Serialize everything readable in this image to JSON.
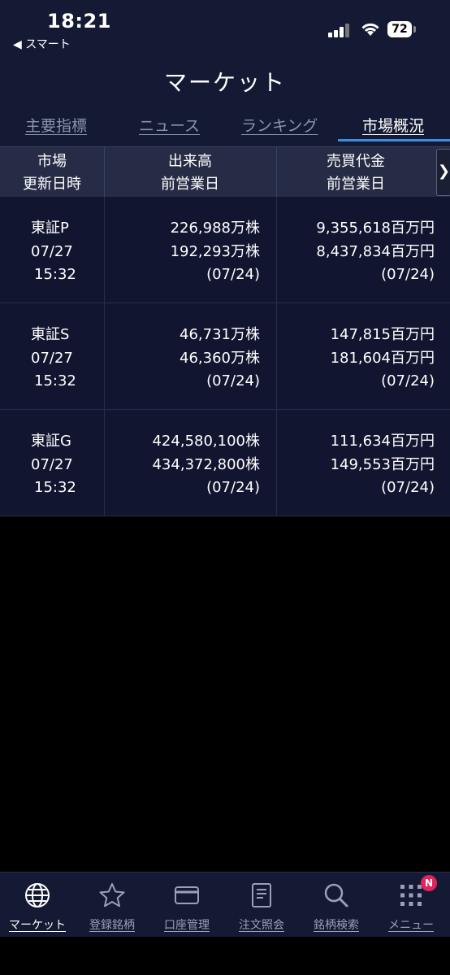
{
  "status_bar": {
    "time": "18:21",
    "back_app": "◀ スマート",
    "battery": "72"
  },
  "header": {
    "title": "マーケット"
  },
  "tabs": [
    {
      "label": "主要指標",
      "active": false
    },
    {
      "label": "ニュース",
      "active": false
    },
    {
      "label": "ランキング",
      "active": false
    },
    {
      "label": "市場概況",
      "active": true
    }
  ],
  "table": {
    "headers": [
      {
        "line1": "市場",
        "line2": "更新日時"
      },
      {
        "line1": "出来高",
        "line2": "前営業日"
      },
      {
        "line1": "売買代金",
        "line2": "前営業日"
      }
    ],
    "scroll_right": "❯",
    "rows": [
      {
        "market": "東証P",
        "date": "07/27",
        "time": "15:32",
        "volume": "226,988万株",
        "volume_prev": "192,293万株",
        "volume_prev_date": "(07/24)",
        "value": "9,355,618百万円",
        "value_prev": "8,437,834百万円",
        "value_prev_date": "(07/24)"
      },
      {
        "market": "東証S",
        "date": "07/27",
        "time": "15:32",
        "volume": "46,731万株",
        "volume_prev": "46,360万株",
        "volume_prev_date": "(07/24)",
        "value": "147,815百万円",
        "value_prev": "181,604百万円",
        "value_prev_date": "(07/24)"
      },
      {
        "market": "東証G",
        "date": "07/27",
        "time": "15:32",
        "volume": "424,580,100株",
        "volume_prev": "434,372,800株",
        "volume_prev_date": "(07/24)",
        "value": "111,634百万円",
        "value_prev": "149,553百万円",
        "value_prev_date": "(07/24)"
      }
    ]
  },
  "tab_bar": {
    "items": [
      {
        "label": "マーケット",
        "icon": "globe-icon",
        "active": true
      },
      {
        "label": "登録銘柄",
        "icon": "star-icon",
        "active": false
      },
      {
        "label": "口座管理",
        "icon": "card-icon",
        "active": false
      },
      {
        "label": "注文照会",
        "icon": "document-icon",
        "active": false
      },
      {
        "label": "銘柄検索",
        "icon": "search-icon",
        "active": false
      },
      {
        "label": "メニュー",
        "icon": "grid-menu-icon",
        "active": false
      }
    ],
    "badge": "N"
  },
  "colors": {
    "header_bg": "#141a33",
    "row_bg": "#111530",
    "accent": "#3c8ce0",
    "badge": "#e0245e"
  }
}
